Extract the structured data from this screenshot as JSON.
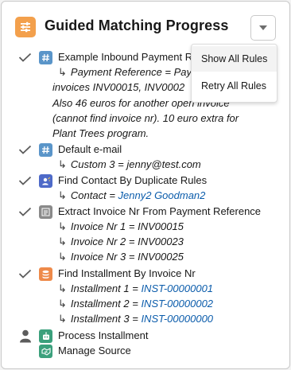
{
  "card": {
    "title": "Guided Matching Progress",
    "header_icon": "sliders-icon",
    "menu_icon": "chevron-down-icon"
  },
  "menu": {
    "items": [
      {
        "label": "Show All Rules"
      },
      {
        "label": "Retry All Rules"
      }
    ]
  },
  "steps": [
    {
      "label": "Example Inbound Payment R",
      "status": "check",
      "icon": "hash-icon",
      "icon_color": "#5a95c9",
      "details": [
        {
          "label": "Payment Reference = Pay",
          "link": ""
        }
      ],
      "continuation": [
        "invoices INV00015, INV0002",
        "Also 46 euros for another open invoice",
        "(cannot find invoice nr). 10 euro extra for",
        "Plant Trees program."
      ]
    },
    {
      "label": "Default e-mail",
      "status": "check",
      "icon": "hash-icon",
      "icon_color": "#5a95c9",
      "details": [
        {
          "label": "Custom 3 = jenny@test.com",
          "link": ""
        }
      ]
    },
    {
      "label": "Find Contact By Duplicate Rules",
      "status": "check",
      "icon": "contact-icon",
      "icon_color": "#4e6ac8",
      "details": [
        {
          "label": "Contact = ",
          "link": "Jenny2 Goodman2"
        }
      ]
    },
    {
      "label": "Extract Invoice Nr From Payment Reference",
      "status": "check",
      "icon": "list-icon",
      "icon_color": "#8a8a8a",
      "details": [
        {
          "label": "Invoice Nr 1 = INV00015",
          "link": ""
        },
        {
          "label": "Invoice Nr 2 = INV00023",
          "link": ""
        },
        {
          "label": "Invoice Nr 3 = INV00025",
          "link": ""
        }
      ]
    },
    {
      "label": "Find Installment By Invoice Nr",
      "status": "check",
      "icon": "database-icon",
      "icon_color": "#ee8a4a",
      "details": [
        {
          "label": "Installment 1 = ",
          "link": "INST-00000001"
        },
        {
          "label": "Installment 2 = ",
          "link": "INST-00000002"
        },
        {
          "label": "Installment 3 = ",
          "link": "INST-00000000"
        }
      ]
    },
    {
      "label": "Process Installment",
      "status": "person",
      "icon": "robot-icon",
      "icon_color": "#3ba07c",
      "details": []
    },
    {
      "label": "Manage Source",
      "status": "none",
      "icon": "handshake-icon",
      "icon_color": "#3ba07c",
      "details": []
    }
  ],
  "colors": {
    "accent_orange": "#f3a04c",
    "link_blue": "#0b5cab",
    "check_gray": "#5c5c5c"
  }
}
